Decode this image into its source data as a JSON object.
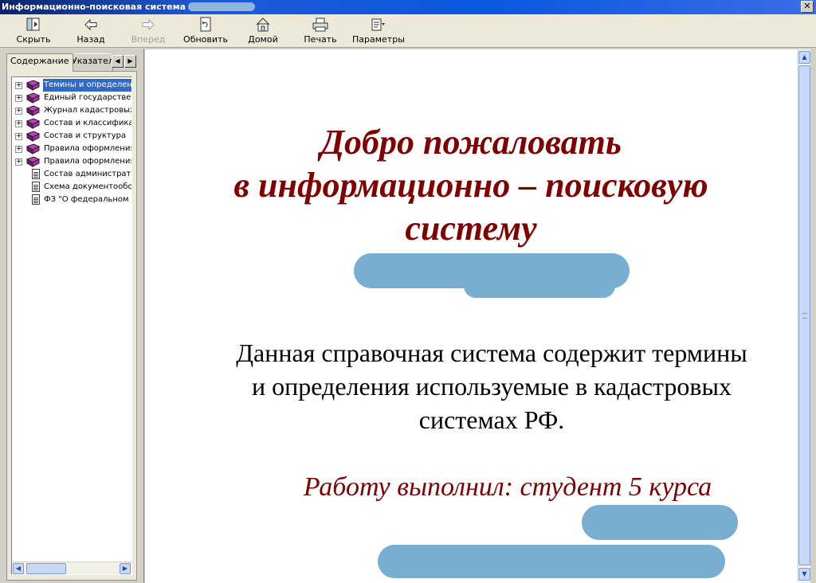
{
  "window": {
    "title": "Информационно-поисковая система",
    "close_label": "✕"
  },
  "toolbar": {
    "hide": "Скрыть",
    "back": "Назад",
    "forward": "Вперед",
    "refresh": "Обновить",
    "home": "Домой",
    "print": "Печать",
    "options": "Параметры"
  },
  "tabs": {
    "contents": "Содержание",
    "index": "Указатель"
  },
  "tree": [
    {
      "label": "Темины и определения",
      "kind": "book",
      "selected": true
    },
    {
      "label": "Единый государственный",
      "kind": "book"
    },
    {
      "label": "Журнал кадастровых",
      "kind": "book"
    },
    {
      "label": "Состав и классификация",
      "kind": "book"
    },
    {
      "label": "Состав и структура",
      "kind": "book"
    },
    {
      "label": "Правила оформления",
      "kind": "book"
    },
    {
      "label": "Правила оформления",
      "kind": "book"
    },
    {
      "label": "Состав административ",
      "kind": "doc"
    },
    {
      "label": "Схема документооборота",
      "kind": "doc"
    },
    {
      "label": "ФЗ \"О федеральном",
      "kind": "doc"
    }
  ],
  "content": {
    "welcome_line1": "Добро пожаловать",
    "welcome_line2": "в информационно – поисковую",
    "welcome_line3": "систему",
    "description": "Данная справочная система содержит термины и определения используемые в кадастровых системах РФ.",
    "author": "Работу выполнил: студент 5 курса"
  },
  "colors": {
    "heading": "#800000",
    "redaction": "#7aaed0",
    "selection": "#316ac5"
  },
  "icons": {
    "hide": "hide-pane-icon",
    "back": "back-arrow-icon",
    "forward": "forward-arrow-icon",
    "refresh": "refresh-icon",
    "home": "home-icon",
    "print": "printer-icon",
    "options": "options-icon"
  }
}
